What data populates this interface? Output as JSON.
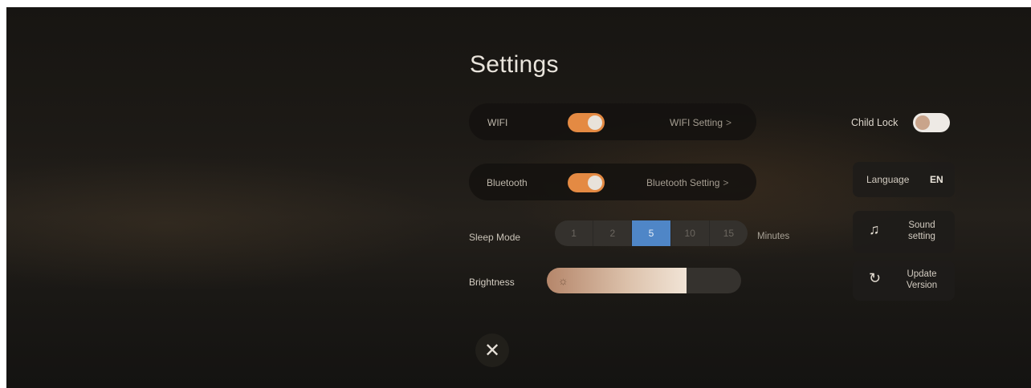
{
  "title": "Settings",
  "wifi": {
    "label": "WIFI",
    "on": true,
    "link": "WIFI Setting",
    "chevron": ">"
  },
  "bluetooth": {
    "label": "Bluetooth",
    "on": true,
    "link": "Bluetooth Setting",
    "chevron": ">"
  },
  "sleep": {
    "label": "Sleep Mode",
    "options": [
      "1",
      "2",
      "5",
      "10",
      "15"
    ],
    "selected": "5",
    "unit": "Minutes"
  },
  "brightness": {
    "label": "Brightness",
    "level": 0.72,
    "icon": "sun-icon"
  },
  "child_lock": {
    "label": "Child Lock",
    "on": false
  },
  "language": {
    "label": "Language",
    "value": "EN"
  },
  "sound": {
    "line1": "Sound",
    "line2": "setting",
    "icon": "music-note-icon"
  },
  "update": {
    "line1": "Update",
    "line2": "Version",
    "icon": "refresh-icon"
  },
  "close": {
    "icon": "close-icon",
    "glyph": "✕"
  },
  "colors": {
    "accent": "#e48a43",
    "selected": "#4f86c7",
    "background": "#1d1a16"
  }
}
